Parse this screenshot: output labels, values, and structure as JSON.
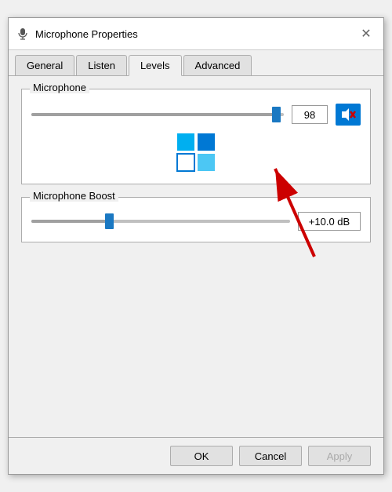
{
  "window": {
    "title": "Microphone Properties",
    "icon": "microphone-icon"
  },
  "tabs": [
    {
      "label": "General",
      "active": false
    },
    {
      "label": "Listen",
      "active": false
    },
    {
      "label": "Levels",
      "active": true
    },
    {
      "label": "Advanced",
      "active": false
    }
  ],
  "microphone": {
    "label": "Microphone",
    "volume": "98",
    "slider_percent": 97,
    "muted": false
  },
  "boost": {
    "label": "Microphone Boost",
    "value": "+10.0 dB",
    "slider_percent": 30
  },
  "footer": {
    "ok_label": "OK",
    "cancel_label": "Cancel",
    "apply_label": "Apply"
  }
}
